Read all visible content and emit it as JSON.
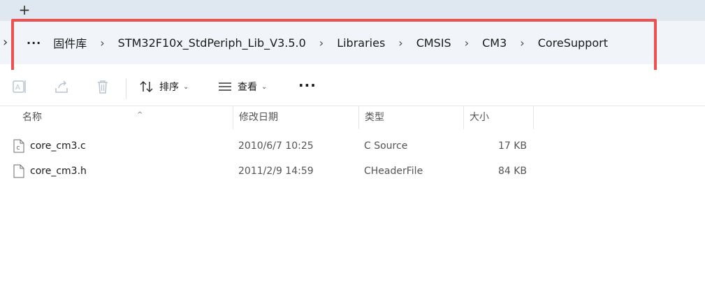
{
  "tabstrip": {
    "new_tab_label": "+"
  },
  "address": {
    "overflow_label": "···",
    "crumbs": [
      {
        "label": "固件库"
      },
      {
        "label": "STM32F10x_StdPeriph_Lib_V3.5.0"
      },
      {
        "label": "Libraries"
      },
      {
        "label": "CMSIS"
      },
      {
        "label": "CM3"
      },
      {
        "label": "CoreSupport"
      }
    ],
    "separator": "›",
    "left_chevron": "›"
  },
  "toolbar": {
    "sort_label": "排序",
    "view_label": "查看",
    "more_label": "···",
    "caret": "⌄"
  },
  "columns": {
    "name": "名称",
    "modified": "修改日期",
    "type": "类型",
    "size": "大小",
    "sort_indicator": "^"
  },
  "files": [
    {
      "name": "core_cm3.c",
      "modified": "2010/6/7 10:25",
      "type": "C Source",
      "size": "17 KB",
      "icon": "c-source-file-icon"
    },
    {
      "name": "core_cm3.h",
      "modified": "2011/2/9 14:59",
      "type": "CHeaderFile",
      "size": "84 KB",
      "icon": "header-file-icon"
    }
  ],
  "colors": {
    "highlight": "#ee5050",
    "address_bg": "#f1f4f8",
    "tab_bg": "#dfe8f1"
  }
}
